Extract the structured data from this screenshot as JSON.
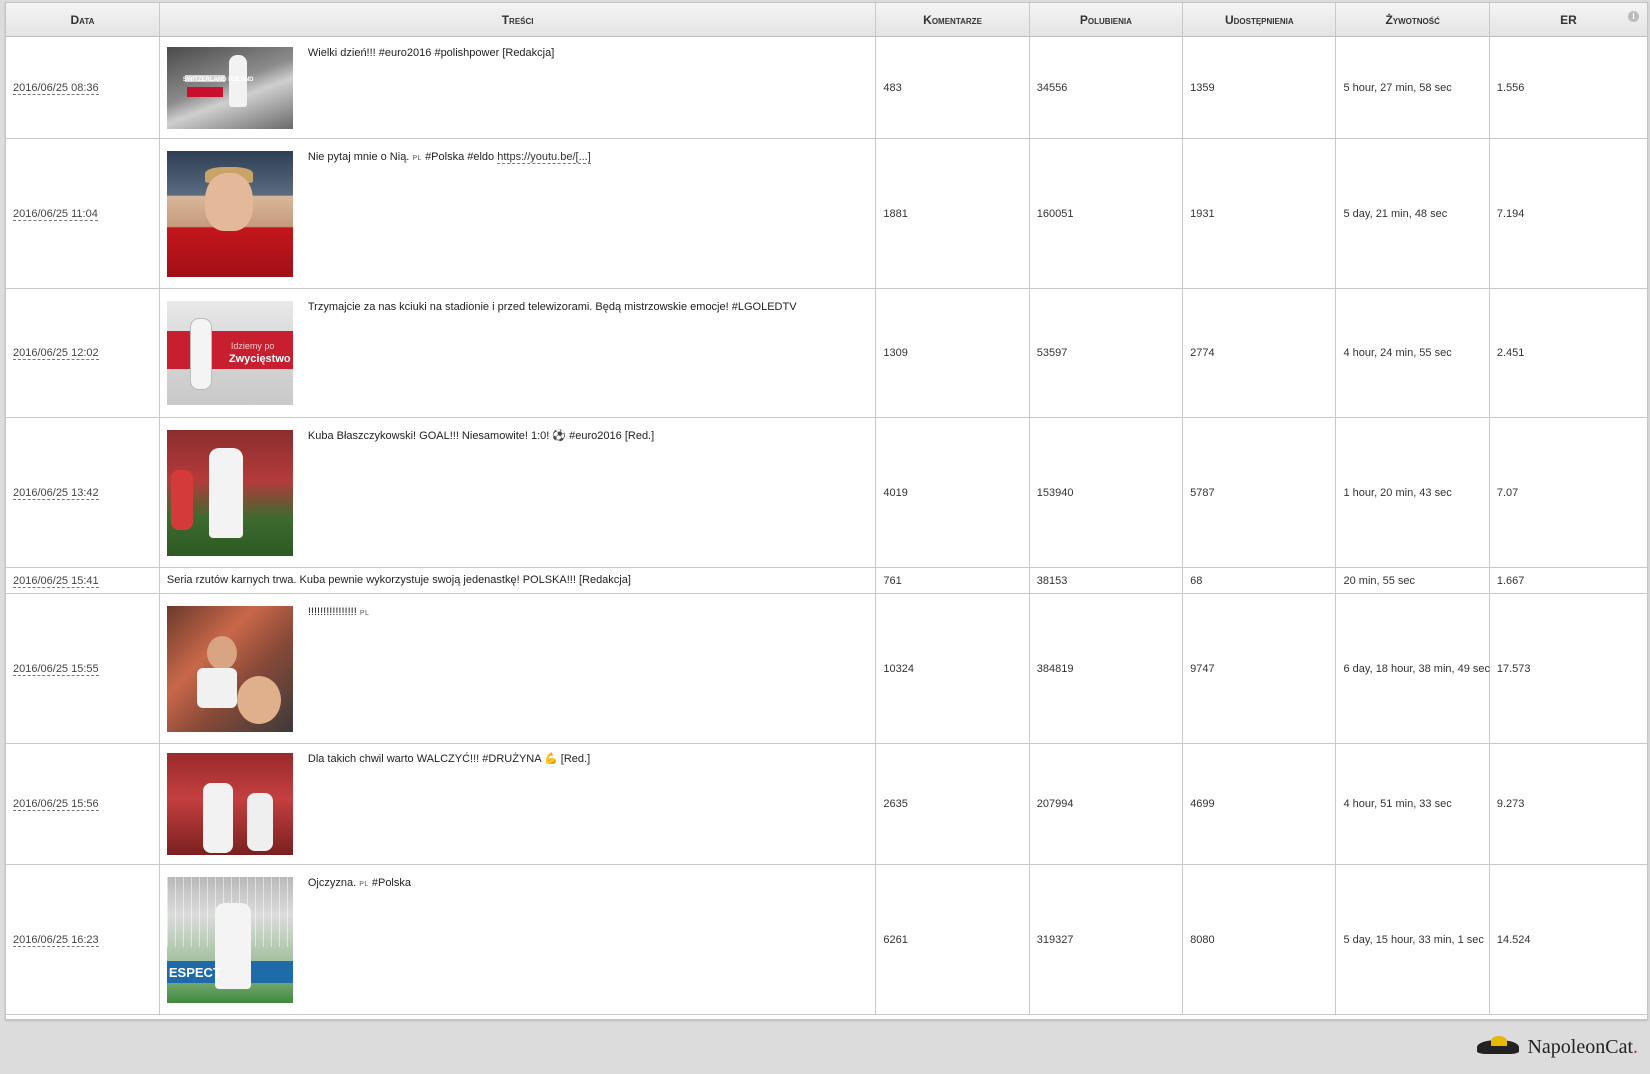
{
  "table": {
    "columns": {
      "date": "Data",
      "content": "Treści",
      "comments": "Komentarze",
      "likes": "Polubienia",
      "shares": "Udostępnienia",
      "lifetime": "Żywotność",
      "er": "ER"
    },
    "info_icon": "i",
    "rows": [
      {
        "date": "2016/06/25 08:36",
        "text": "Wielki dzień!!! #euro2016 #polishpower [Redakcja]",
        "thumb_caption": "SWITZERLAND POLAND",
        "comments": "483",
        "likes": "34556",
        "shares": "1359",
        "lifetime": "5 hour, 27 min, 58 sec",
        "er": "1.556"
      },
      {
        "date": "2016/06/25 11:04",
        "text_before_flag": "Nie pytaj mnie o Nią.",
        "flag": "PL",
        "text_after_flag": "#Polska #eldo",
        "link": "https://youtu.be/[...]",
        "comments": "1881",
        "likes": "160051",
        "shares": "1931",
        "lifetime": "5 day, 21 min, 48 sec",
        "er": "7.194"
      },
      {
        "date": "2016/06/25 12:02",
        "text": "Trzymajcie za nas kciuki na stadionie i przed telewizorami. Będą mistrzowskie emocje! #LGOLEDTV",
        "thumb_caption_small": "Idziemy po",
        "thumb_caption_big": "Zwycięstwo",
        "comments": "1309",
        "likes": "53597",
        "shares": "2774",
        "lifetime": "4 hour, 24 min, 55 sec",
        "er": "2.451"
      },
      {
        "date": "2016/06/25 13:42",
        "text": "Kuba Błaszczykowski! GOAL!!! Niesamowite! 1:0! ⚽ #euro2016 [Red.]",
        "comments": "4019",
        "likes": "153940",
        "shares": "5787",
        "lifetime": "1 hour, 20 min, 43 sec",
        "er": "7.07"
      },
      {
        "date": "2016/06/25 15:41",
        "text": "Seria rzutów karnych trwa. Kuba pewnie wykorzystuje swoją jedenastkę! POLSKA!!! [Redakcja]",
        "comments": "761",
        "likes": "38153",
        "shares": "68",
        "lifetime": "20 min, 55 sec",
        "er": "1.667"
      },
      {
        "date": "2016/06/25 15:55",
        "text": "!!!!!!!!!!!!!!!!",
        "flag": "PL",
        "comments": "10324",
        "likes": "384819",
        "shares": "9747",
        "lifetime": "6 day, 18 hour, 38 min, 49 sec",
        "er": "17.573"
      },
      {
        "date": "2016/06/25 15:56",
        "text": "Dla takich chwil warto WALCZYĆ!!! #DRUŻYNA 💪 [Red.]",
        "comments": "2635",
        "likes": "207994",
        "shares": "4699",
        "lifetime": "4 hour, 51 min, 33 sec",
        "er": "9.273"
      },
      {
        "date": "2016/06/25 16:23",
        "text_before_flag": "Ojczyzna.",
        "flag": "PL",
        "text_after_flag": "#Polska",
        "thumb_caption": "ESPECT",
        "comments": "6261",
        "likes": "319327",
        "shares": "8080",
        "lifetime": "5 day, 15 hour, 33 min, 1 sec",
        "er": "14.524"
      }
    ]
  },
  "footer": {
    "brand": "NapoleonCat",
    "brand_dot": ".",
    "logo_icon": "napoleon-cat-hat-logo"
  }
}
